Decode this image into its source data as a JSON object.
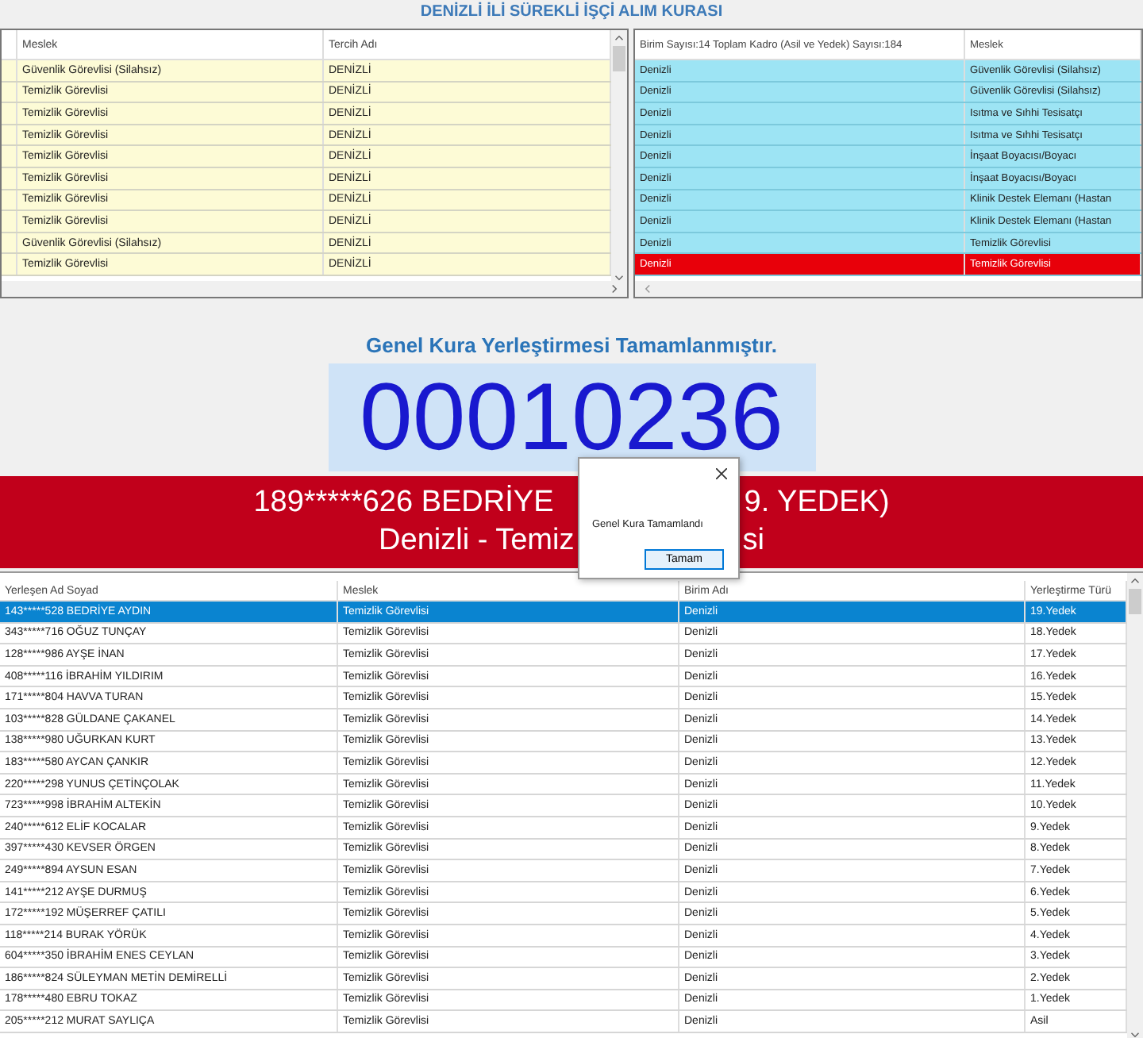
{
  "window": {
    "title": "DENİZLİ İLİ SÜREKLİ İŞÇİ ALIM KURASI"
  },
  "choices_table": {
    "columns": [
      "Meslek",
      "Tercih Adı"
    ],
    "rows": [
      {
        "cells": [
          "Güvenlik Görevlisi (Silahsız)",
          "DENİZLİ"
        ]
      },
      {
        "cells": [
          "Temizlik Görevlisi",
          "DENİZLİ"
        ]
      },
      {
        "cells": [
          "Temizlik Görevlisi",
          "DENİZLİ"
        ]
      },
      {
        "cells": [
          "Temizlik Görevlisi",
          "DENİZLİ"
        ]
      },
      {
        "cells": [
          "Temizlik Görevlisi",
          "DENİZLİ"
        ]
      },
      {
        "cells": [
          "Temizlik Görevlisi",
          "DENİZLİ"
        ]
      },
      {
        "cells": [
          "Temizlik Görevlisi",
          "DENİZLİ"
        ]
      },
      {
        "cells": [
          "Temizlik Görevlisi",
          "DENİZLİ"
        ]
      },
      {
        "cells": [
          "Güvenlik Görevlisi (Silahsız)",
          "DENİZLİ"
        ]
      },
      {
        "cells": [
          "Temizlik Görevlisi",
          "DENİZLİ"
        ]
      }
    ]
  },
  "units_table": {
    "columns": [
      "Birim Sayısı:14 Toplam Kadro (Asil ve Yedek) Sayısı:184",
      "Meslek"
    ],
    "rows": [
      {
        "cells": [
          "Denizli",
          "Güvenlik Görevlisi (Silahsız)"
        ],
        "selected": false
      },
      {
        "cells": [
          "Denizli",
          "Güvenlik Görevlisi (Silahsız)"
        ],
        "selected": false
      },
      {
        "cells": [
          "Denizli",
          "Isıtma ve Sıhhi Tesisatçı"
        ],
        "selected": false
      },
      {
        "cells": [
          "Denizli",
          "Isıtma ve Sıhhi Tesisatçı"
        ],
        "selected": false
      },
      {
        "cells": [
          "Denizli",
          "İnşaat Boyacısı/Boyacı"
        ],
        "selected": false
      },
      {
        "cells": [
          "Denizli",
          "İnşaat Boyacısı/Boyacı"
        ],
        "selected": false
      },
      {
        "cells": [
          "Denizli",
          "Klinik Destek Elemanı (Hastan"
        ],
        "selected": false
      },
      {
        "cells": [
          "Denizli",
          "Klinik Destek Elemanı (Hastan"
        ],
        "selected": false
      },
      {
        "cells": [
          "Denizli",
          "Temizlik Görevlisi"
        ],
        "selected": false
      },
      {
        "cells": [
          "Denizli",
          "Temizlik Görevlisi"
        ],
        "selected": true
      }
    ]
  },
  "status": {
    "message": "Genel Kura Yerleştirmesi Tamamlanmıştır.",
    "number": "00010236"
  },
  "banner": {
    "lines": [
      [
        "189*****626 BEDRİYE",
        "9. YEDEK)"
      ],
      [
        "Denizli - Temiz",
        "si"
      ]
    ]
  },
  "dialog": {
    "message": "Genel Kura Tamamlandı",
    "button": "Tamam"
  },
  "placements_table": {
    "columns": [
      "Yerleşen Ad Soyad",
      "Meslek",
      "Birim Adı",
      "Yerleştirme Türü"
    ],
    "rows": [
      {
        "cells": [
          "143*****528 BEDRİYE AYDIN",
          "Temizlik Görevlisi",
          "Denizli",
          "19.Yedek"
        ],
        "selected": true
      },
      {
        "cells": [
          "343*****716 OĞUZ TUNÇAY",
          "Temizlik Görevlisi",
          "Denizli",
          "18.Yedek"
        ],
        "selected": false
      },
      {
        "cells": [
          "128*****986 AYŞE İNAN",
          "Temizlik Görevlisi",
          "Denizli",
          "17.Yedek"
        ],
        "selected": false
      },
      {
        "cells": [
          "408*****116 İBRAHİM YILDIRIM",
          "Temizlik Görevlisi",
          "Denizli",
          "16.Yedek"
        ],
        "selected": false
      },
      {
        "cells": [
          "171*****804 HAVVA TURAN",
          "Temizlik Görevlisi",
          "Denizli",
          "15.Yedek"
        ],
        "selected": false
      },
      {
        "cells": [
          "103*****828 GÜLDANE ÇAKANEL",
          "Temizlik Görevlisi",
          "Denizli",
          "14.Yedek"
        ],
        "selected": false
      },
      {
        "cells": [
          "138*****980 UĞURKAN KURT",
          "Temizlik Görevlisi",
          "Denizli",
          "13.Yedek"
        ],
        "selected": false
      },
      {
        "cells": [
          "183*****580 AYCAN ÇANKIR",
          "Temizlik Görevlisi",
          "Denizli",
          "12.Yedek"
        ],
        "selected": false
      },
      {
        "cells": [
          "220*****298 YUNUS ÇETİNÇOLAK",
          "Temizlik Görevlisi",
          "Denizli",
          "11.Yedek"
        ],
        "selected": false
      },
      {
        "cells": [
          "723*****998 İBRAHİM ALTEKİN",
          "Temizlik Görevlisi",
          "Denizli",
          "10.Yedek"
        ],
        "selected": false
      },
      {
        "cells": [
          "240*****612 ELİF KOCALAR",
          "Temizlik Görevlisi",
          "Denizli",
          "9.Yedek"
        ],
        "selected": false
      },
      {
        "cells": [
          "397*****430 KEVSER ÖRGEN",
          "Temizlik Görevlisi",
          "Denizli",
          "8.Yedek"
        ],
        "selected": false
      },
      {
        "cells": [
          "249*****894 AYSUN ESAN",
          "Temizlik Görevlisi",
          "Denizli",
          "7.Yedek"
        ],
        "selected": false
      },
      {
        "cells": [
          "141*****212 AYŞE DURMUŞ",
          "Temizlik Görevlisi",
          "Denizli",
          "6.Yedek"
        ],
        "selected": false
      },
      {
        "cells": [
          "172*****192 MÜŞERREF ÇATILI",
          "Temizlik Görevlisi",
          "Denizli",
          "5.Yedek"
        ],
        "selected": false
      },
      {
        "cells": [
          "118*****214 BURAK YÖRÜK",
          "Temizlik Görevlisi",
          "Denizli",
          "4.Yedek"
        ],
        "selected": false
      },
      {
        "cells": [
          "604*****350 İBRAHİM ENES CEYLAN",
          "Temizlik Görevlisi",
          "Denizli",
          "3.Yedek"
        ],
        "selected": false
      },
      {
        "cells": [
          "186*****824 SÜLEYMAN METİN DEMİRELLİ",
          "Temizlik Görevlisi",
          "Denizli",
          "2.Yedek"
        ],
        "selected": false
      },
      {
        "cells": [
          "178*****480 EBRU TOKAZ",
          "Temizlik Görevlisi",
          "Denizli",
          "1.Yedek"
        ],
        "selected": false
      },
      {
        "cells": [
          "205*****212 MURAT SAYLIÇA",
          "Temizlik Görevlisi",
          "Denizli",
          "Asil"
        ],
        "selected": false
      }
    ]
  }
}
